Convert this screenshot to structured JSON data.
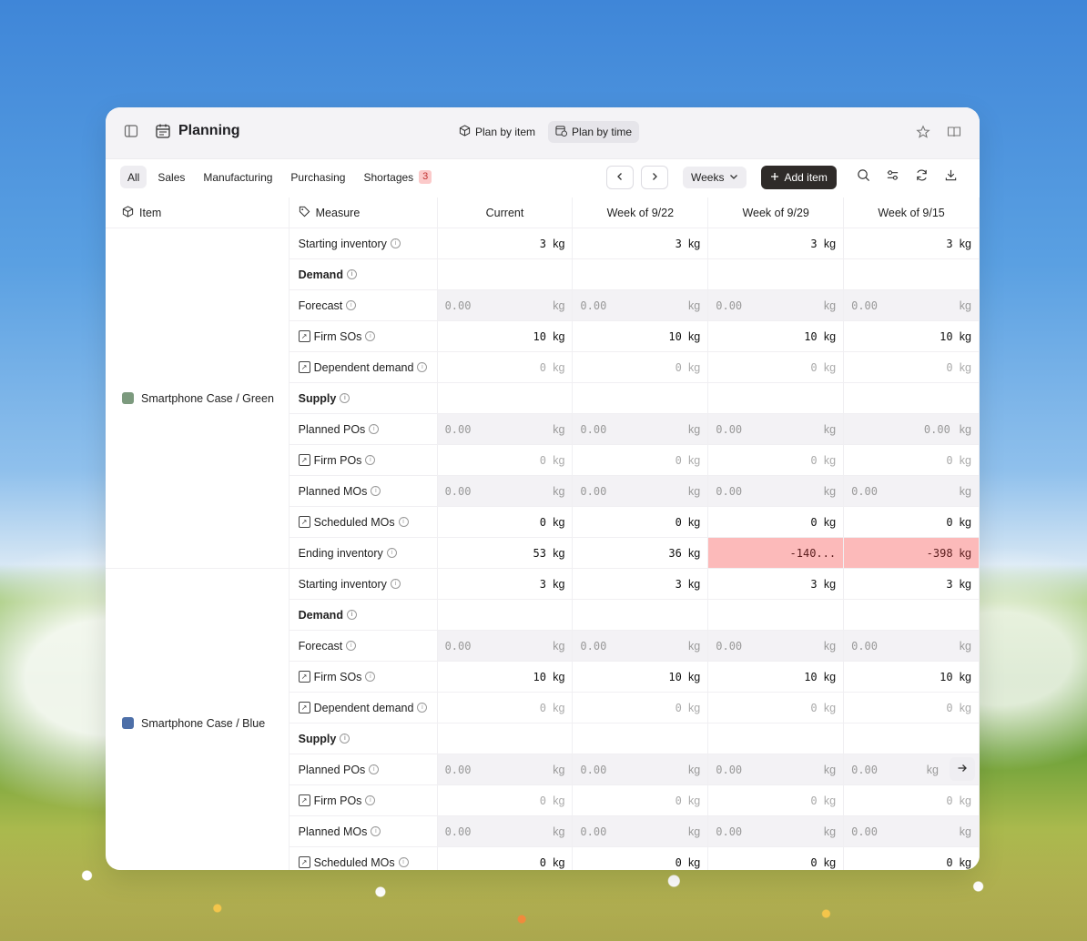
{
  "app": {
    "title": "Planning"
  },
  "views": {
    "by_item": "Plan by item",
    "by_time": "Plan by time"
  },
  "filters": {
    "all": "All",
    "sales": "Sales",
    "manufacturing": "Manufacturing",
    "purchasing": "Purchasing",
    "shortages": "Shortages",
    "shortages_count": "3"
  },
  "toolbar": {
    "period": "Weeks",
    "add_item": "Add item"
  },
  "columns": {
    "item": "Item",
    "measure": "Measure",
    "c0": "Current",
    "c1": "Week of 9/22",
    "c2": "Week of 9/29",
    "c3": "Week of 9/15"
  },
  "items": [
    {
      "name": "Smartphone Case / Green",
      "swatch": "#7c9a7e"
    },
    {
      "name": "Smartphone Case / Blue",
      "swatch": "#4d6fa8"
    }
  ],
  "measures": {
    "starting_inventory": "Starting inventory",
    "demand": "Demand",
    "forecast": "Forecast",
    "firm_sos": "Firm SOs",
    "dependent_demand": "Dependent demand",
    "supply": "Supply",
    "planned_pos": "Planned POs",
    "firm_pos": "Firm POs",
    "planned_mos": "Planned MOs",
    "scheduled_mos": "Scheduled MOs",
    "ending_inventory": "Ending inventory"
  },
  "units": {
    "kg": "kg"
  },
  "values": {
    "start": "3",
    "zero_dec": "0.00",
    "firm_sos": "10",
    "zero": "0",
    "end0": "53",
    "end1": "36",
    "end2": "-140...",
    "end3": "-398"
  }
}
